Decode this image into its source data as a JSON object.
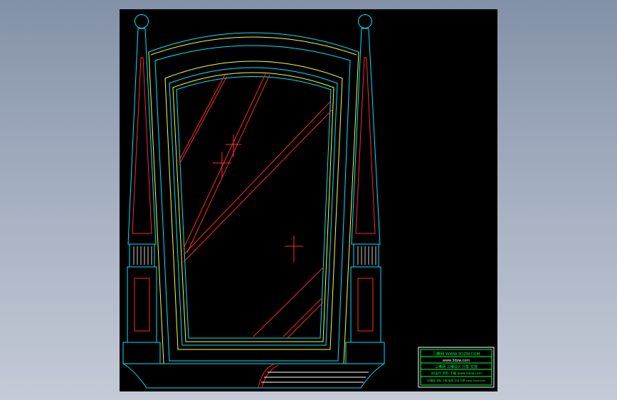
{
  "viewer": {
    "background_top": "#8391a8",
    "background_bottom": "#c4cad6",
    "canvas_color": "#000000"
  },
  "drawing": {
    "subject": "vanity mirror elevation",
    "line_colors": {
      "cyan": "#00e5ff",
      "yellow": "#ffff33",
      "red": "#ff2a2a",
      "white": "#ffffff",
      "green": "#00ff40"
    }
  },
  "title_block": {
    "line1": "三维网  WWW.3DZW.COM",
    "line2": "www.3dzw.com",
    "line3": "三维网 三维设计 分享 交流",
    "line4": "3D设计 资料 下载 www.3dzw.com",
    "line5": "3D模型 资料 下载 免费 交流 分享 www.3dzw.com"
  }
}
